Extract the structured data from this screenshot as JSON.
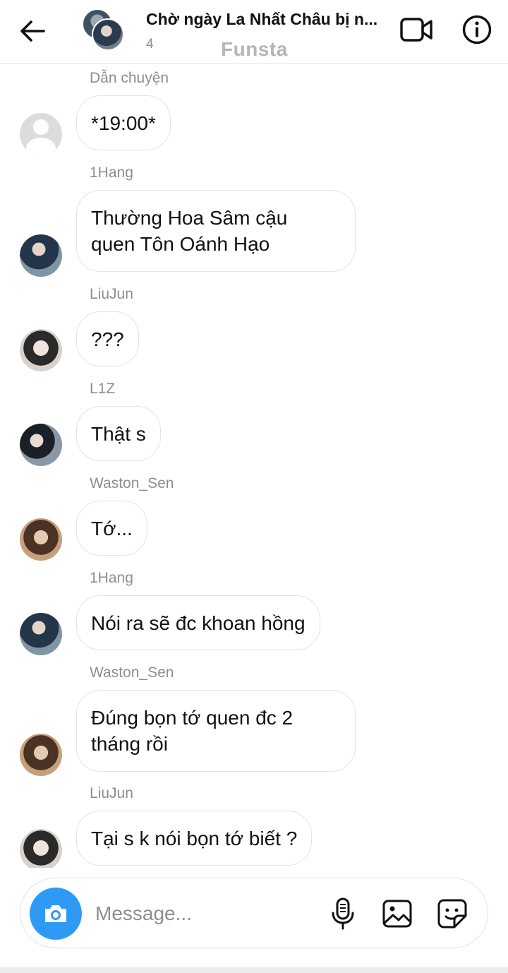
{
  "header": {
    "title": "Chờ ngày La Nhất Châu bị n...",
    "member_count": "4",
    "watermark": "Funsta",
    "icons": [
      "back-arrow-icon",
      "video-camera-icon",
      "info-icon"
    ]
  },
  "messages": [
    {
      "sender": "Dẫn chuyện",
      "lines": [
        "*19:00*"
      ],
      "avatar": "default"
    },
    {
      "sender": "1Hang",
      "lines": [
        "Thường Hoa Sâm cậu",
        "quen Tôn Oánh Hạo"
      ],
      "avatar": "1hang"
    },
    {
      "sender": "LiuJun",
      "lines": [
        "???"
      ],
      "avatar": "liujun"
    },
    {
      "sender": "L1Z",
      "lines": [
        "Thật s"
      ],
      "avatar": "l1z"
    },
    {
      "sender": "Waston_Sen",
      "lines": [
        "Tớ..."
      ],
      "avatar": "waston"
    },
    {
      "sender": "1Hang",
      "lines": [
        "Nói ra sẽ đc khoan hồng"
      ],
      "avatar": "1hang"
    },
    {
      "sender": "Waston_Sen",
      "lines": [
        "Đúng bọn tớ quen đc 2",
        "tháng rồi"
      ],
      "avatar": "waston"
    },
    {
      "sender": "LiuJun",
      "lines": [
        "Tại s k nói bọn tớ biết ?"
      ],
      "avatar": "liujun"
    }
  ],
  "composer": {
    "placeholder": "Message...",
    "camera_button_color": "#2f9af5",
    "icons": [
      "camera-icon",
      "microphone-icon",
      "gallery-icon",
      "sticker-icon"
    ]
  }
}
